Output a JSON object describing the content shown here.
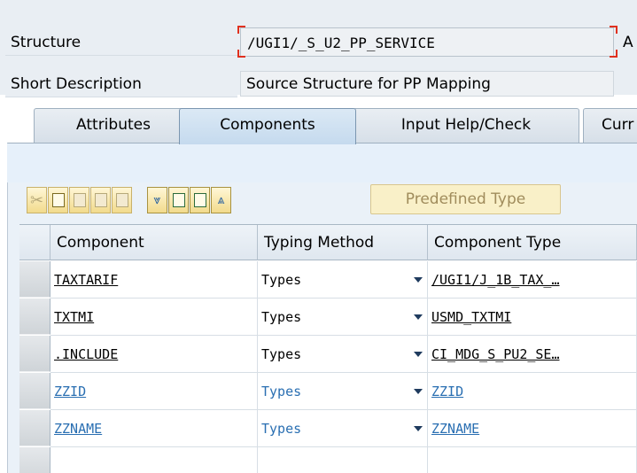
{
  "header": {
    "structure_label": "Structure",
    "structure_value": "/UGI1/_S_U2_PP_SERVICE",
    "structure_trailing": "A",
    "short_desc_label": "Short Description",
    "short_desc_value": "Source Structure for PP Mapping"
  },
  "tabs": [
    {
      "label": "Attributes"
    },
    {
      "label": "Components"
    },
    {
      "label": "Input Help/Check"
    },
    {
      "label": "Curr"
    }
  ],
  "active_tab": "Components",
  "toolbar": {
    "predefined_type_label": "Predefined Type"
  },
  "table": {
    "columns": [
      "Component",
      "Typing Method",
      "Component Type"
    ],
    "rows": [
      {
        "component": "TAXTARIF",
        "typing_method": "Types",
        "component_type": "/UGI1/J_1B_TAX_…",
        "editable": false
      },
      {
        "component": "TXTMI",
        "typing_method": "Types",
        "component_type": "USMD_TXTMI",
        "editable": false
      },
      {
        "component": ".INCLUDE",
        "typing_method": "Types",
        "component_type": "CI_MDG_S_PU2_SE…",
        "editable": false
      },
      {
        "component": "ZZID",
        "typing_method": "Types",
        "component_type": "ZZID",
        "editable": true
      },
      {
        "component": "ZZNAME",
        "typing_method": "Types",
        "component_type": "ZZNAME",
        "editable": true
      },
      {
        "component": "",
        "typing_method": "",
        "component_type": "",
        "editable": true
      }
    ]
  },
  "colors": {
    "editable_text": "#2a6fb2",
    "required_marker": "#e0301e",
    "toolbar_button": "#f2db8c"
  }
}
